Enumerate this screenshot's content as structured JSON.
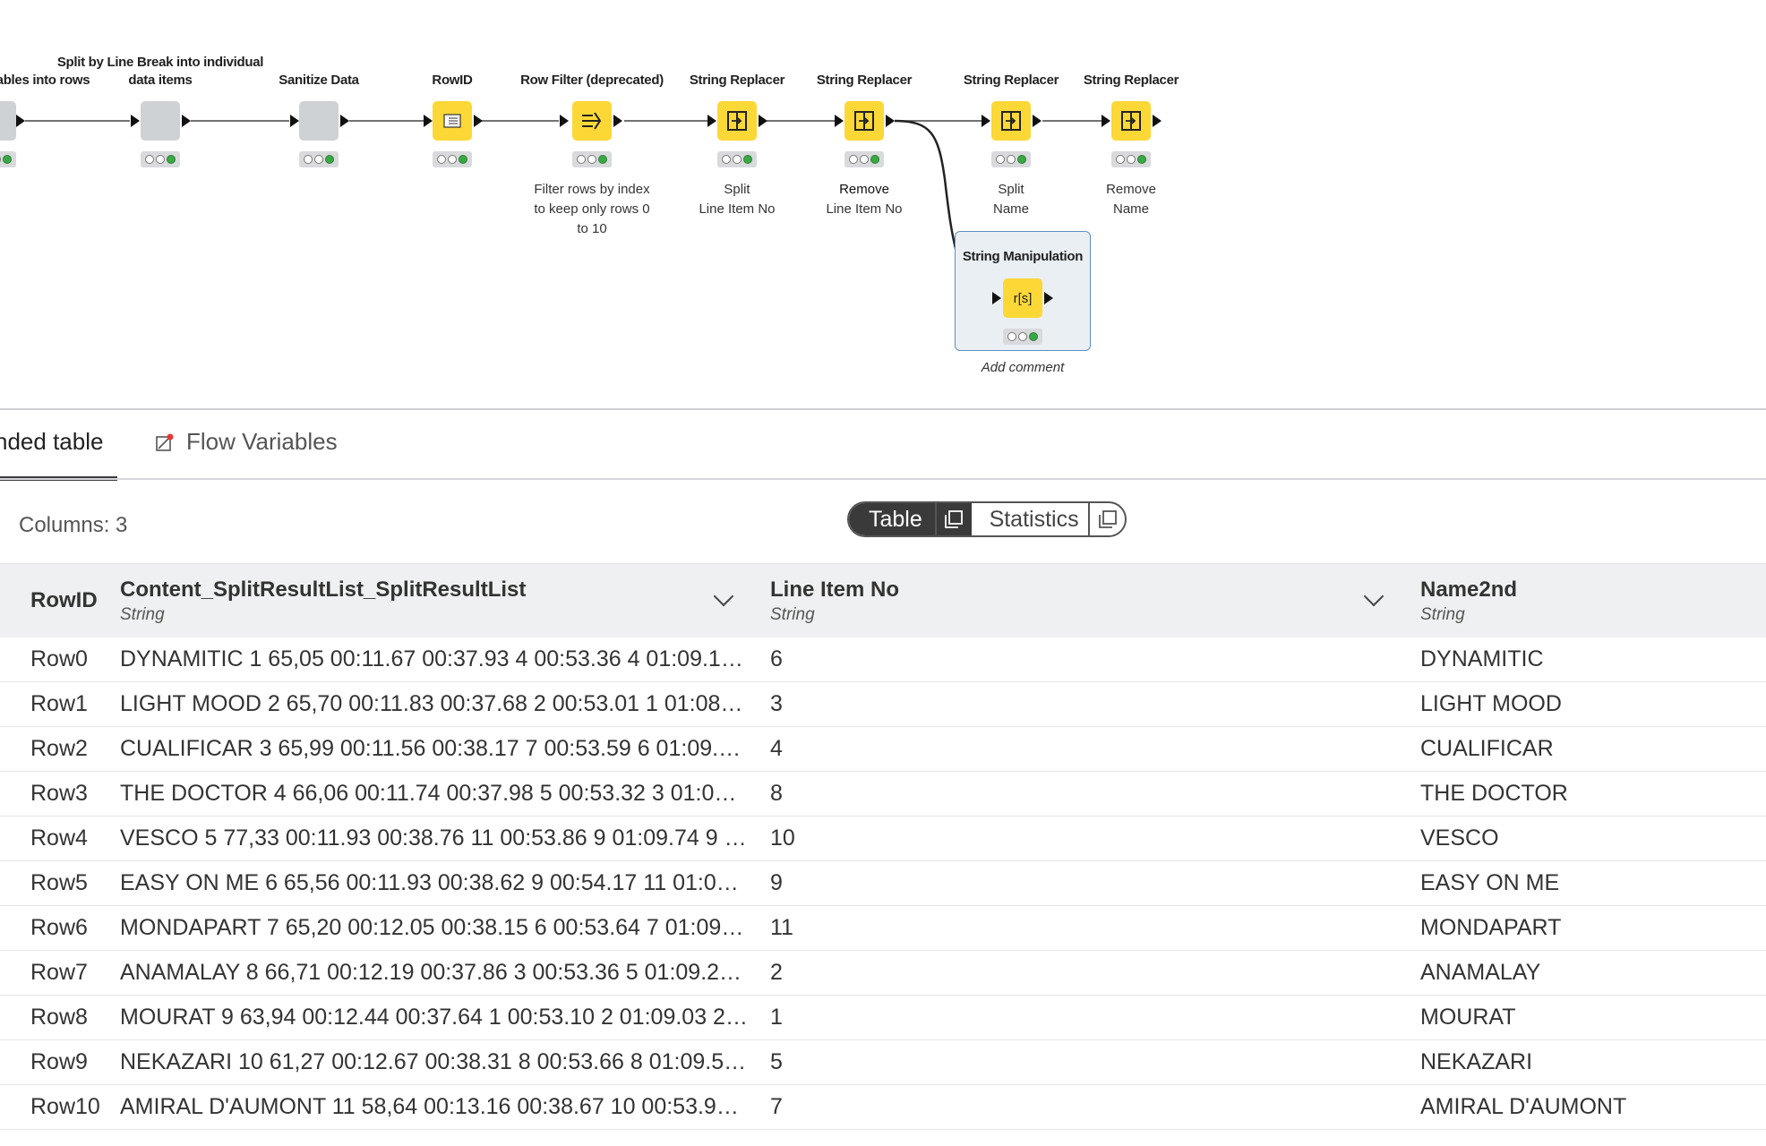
{
  "workflow": {
    "nodes": [
      {
        "title": "ables into rows",
        "status": [
          "empty",
          "empty",
          "green"
        ]
      },
      {
        "title": "Split by Line Break into individual data items",
        "status": [
          "empty",
          "empty",
          "green"
        ]
      },
      {
        "title": "Sanitize Data",
        "status": [
          "empty",
          "empty",
          "green"
        ]
      },
      {
        "title": "RowID",
        "icon": "rowid-icon",
        "status": [
          "empty",
          "empty",
          "green"
        ]
      },
      {
        "title": "Row Filter (deprecated)",
        "icon": "row-filter-icon",
        "description": "Filter rows by index to keep only rows 0 to 10",
        "status": [
          "empty",
          "empty",
          "green"
        ]
      },
      {
        "title": "String Replacer",
        "icon": "string-replacer-icon",
        "description_line1": "Split",
        "description_line2": "Line Item No",
        "status": [
          "empty",
          "empty",
          "green"
        ]
      },
      {
        "title": "String Replacer",
        "icon": "string-replacer-icon",
        "description_line1": "Remove",
        "description_line2": "Line Item No",
        "status": [
          "empty",
          "empty",
          "green"
        ]
      },
      {
        "title": "String Replacer",
        "icon": "string-replacer-icon",
        "description_line1": "Split",
        "description_line2": "Name",
        "status": [
          "empty",
          "empty",
          "green"
        ]
      },
      {
        "title": "String Replacer",
        "icon": "string-replacer-icon",
        "description_line1": "Remove",
        "description_line2": "Name",
        "status": [
          "empty",
          "empty",
          "green"
        ]
      },
      {
        "title": "String Manipulation",
        "icon_text": "r[s]",
        "comment": "Add comment",
        "status": [
          "empty",
          "empty",
          "green"
        ]
      }
    ]
  },
  "tabs": [
    {
      "label": "nded table",
      "active": true
    },
    {
      "label": "Flow Variables",
      "active": false
    }
  ],
  "toolbar": {
    "columns_label": "Columns: 3",
    "view_table": "Table",
    "view_statistics": "Statistics"
  },
  "table": {
    "rowid_header": "RowID",
    "columns": [
      {
        "name": "Content_SplitResultList_SplitResultList",
        "type": "String"
      },
      {
        "name": "Line Item No",
        "type": "String"
      },
      {
        "name": "Name2nd",
        "type": "String"
      }
    ],
    "rows": [
      {
        "id": "Row0",
        "content": "DYNAMITIC 1 65,05 00:11.67 00:37.93 4 00:53.36 4 01:09.1…",
        "line_item": "6",
        "name": "DYNAMITIC"
      },
      {
        "id": "Row1",
        "content": "LIGHT MOOD 2 65,70 00:11.83 00:37.68 2 00:53.01 1 01:08.…",
        "line_item": "3",
        "name": "LIGHT MOOD"
      },
      {
        "id": "Row2",
        "content": "CUALIFICAR 3 65,99 00:11.56 00:38.17 7 00:53.59 6 01:09.…",
        "line_item": "4",
        "name": "CUALIFICAR"
      },
      {
        "id": "Row3",
        "content": "THE DOCTOR 4 66,06 00:11.74 00:37.98 5 00:53.32 3 01:09.…",
        "line_item": "8",
        "name": "THE DOCTOR"
      },
      {
        "id": "Row4",
        "content": "VESCO 5 77,33 00:11.93 00:38.76 11 00:53.86 9 01:09.74 9 …",
        "line_item": "10",
        "name": "VESCO"
      },
      {
        "id": "Row5",
        "content": "EASY ON ME 6 65,56 00:11.93 00:38.62 9 00:54.17 11 01:0…",
        "line_item": "9",
        "name": "EASY ON ME"
      },
      {
        "id": "Row6",
        "content": "MONDAPART 7 65,20 00:12.05 00:38.15 6 00:53.64 7 01:09.…",
        "line_item": "11",
        "name": "MONDAPART"
      },
      {
        "id": "Row7",
        "content": "ANAMALAY 8 66,71 00:12.19 00:37.86 3 00:53.36 5 01:09.2…",
        "line_item": "2",
        "name": "ANAMALAY"
      },
      {
        "id": "Row8",
        "content": "MOURAT 9 63,94 00:12.44 00:37.64 1 00:53.10 2 01:09.03 2…",
        "line_item": "1",
        "name": "MOURAT"
      },
      {
        "id": "Row9",
        "content": "NEKAZARI 10 61,27 00:12.67 00:38.31 8 00:53.66 8 01:09.5…",
        "line_item": "5",
        "name": "NEKAZARI"
      },
      {
        "id": "Row10",
        "content": "AMIRAL D'AUMONT 11 58,64 00:13.16 00:38.67 10 00:53.9…",
        "line_item": "7",
        "name": "AMIRAL D'AUMONT"
      }
    ]
  },
  "colors": {
    "node_yellow": "#fcd837",
    "node_gray": "#cfd2d4",
    "status_green": "#3aa844",
    "selection_border": "#5b8fc3",
    "flow_var_dot": "#e53935"
  }
}
